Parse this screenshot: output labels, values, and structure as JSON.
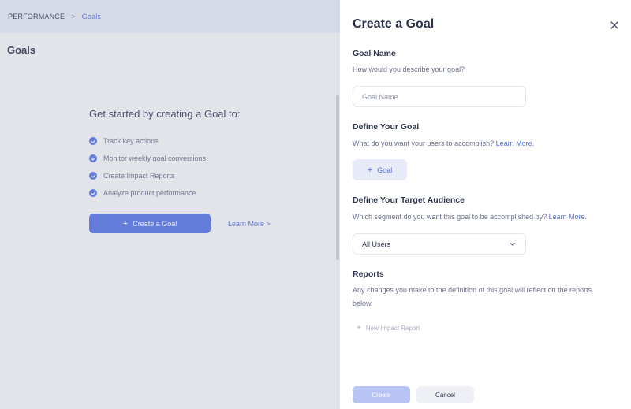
{
  "breadcrumb": {
    "root": "PERFORMANCE",
    "separator": ">",
    "current": "Goals"
  },
  "page": {
    "title": "Goals",
    "intro_heading": "Get started by creating a Goal to:",
    "checklist": [
      "Track key actions",
      "Monitor weekly goal conversions",
      "Create Impact Reports",
      "Analyze product performance"
    ],
    "create_button": "Create a Goal",
    "learn_more": "Learn More >"
  },
  "drawer": {
    "title": "Create a Goal",
    "goal_name": {
      "title": "Goal Name",
      "desc": "How would you describe your goal?",
      "placeholder": "Goal Name",
      "value": ""
    },
    "define_goal": {
      "title": "Define Your Goal",
      "desc": "What do you want your users to accomplish?",
      "link": "Learn More.",
      "button": "Goal"
    },
    "audience": {
      "title": "Define Your Target Audience",
      "desc": "Which segment do you want this goal to be accomplished by?",
      "link": "Learn More.",
      "selected": "All Users"
    },
    "reports": {
      "title": "Reports",
      "desc": "Any changes you make to the definition of this goal will reflect on the reports below.",
      "new_report": "New Impact Report"
    },
    "footer": {
      "create": "Create",
      "cancel": "Cancel"
    }
  },
  "colors": {
    "accent": "#5a76e3",
    "link": "#5670d9",
    "disabled_accent": "#b7c4f4"
  }
}
